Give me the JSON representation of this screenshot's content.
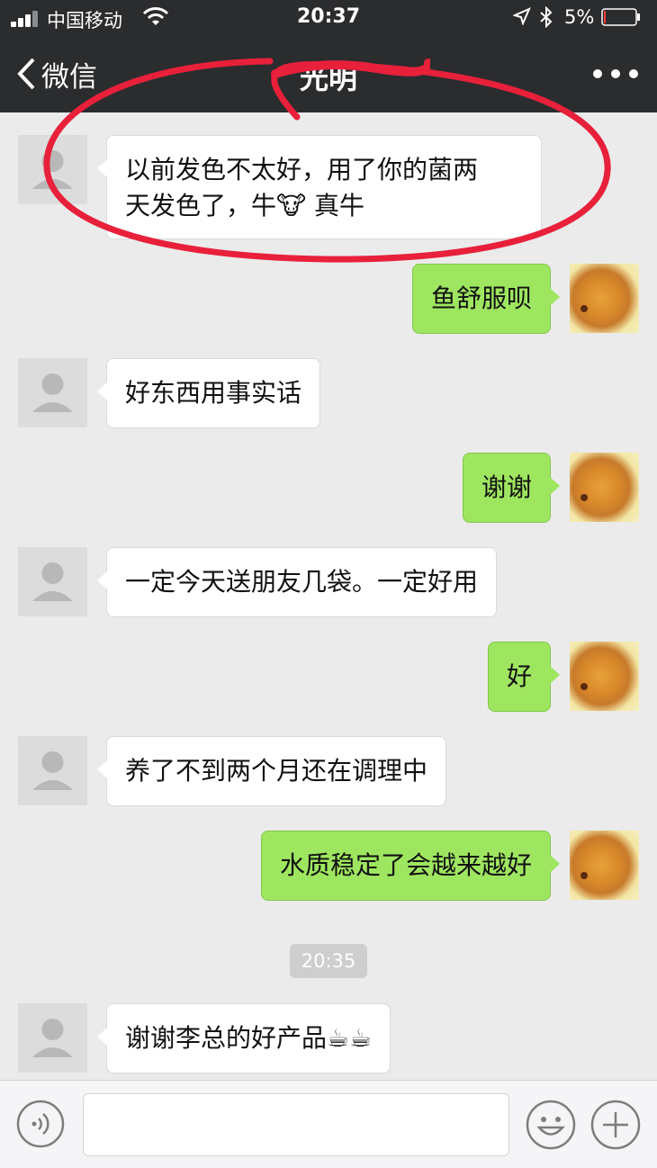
{
  "status_bar": {
    "carrier": "中国移动",
    "time": "20:37",
    "battery_percent": "5%",
    "battery_level": 0.05,
    "battery_color": "#ff3b30"
  },
  "nav": {
    "back_label": "微信",
    "title": "光明",
    "more_icon": "more-dots-icon",
    "back_icon": "chevron-left-icon"
  },
  "colors": {
    "nav_bg": "#2b2c2e",
    "chat_bg": "#ebebeb",
    "outgoing_bubble": "#9fe660",
    "incoming_bubble": "#ffffff",
    "annotation_red": "#e8203a"
  },
  "messages": [
    {
      "side": "in",
      "text": "以前发色不太好，用了你的菌两",
      "text2": "天发色了，牛🐮 真牛"
    },
    {
      "side": "out",
      "text": "鱼舒服呗"
    },
    {
      "side": "in",
      "text": "好东西用事实话"
    },
    {
      "side": "out",
      "text": "谢谢"
    },
    {
      "side": "in",
      "text": "一定今天送朋友几袋。一定好用"
    },
    {
      "side": "out",
      "text": "好"
    },
    {
      "side": "in",
      "text": "养了不到两个月还在调理中"
    },
    {
      "side": "out",
      "text": "水质稳定了会越来越好"
    },
    {
      "side": "in",
      "text": "谢谢李总的好产品☕☕"
    }
  ],
  "timestamp": "20:35",
  "input_bar": {
    "voice_icon": "voice-icon",
    "input_value": "",
    "emoji_icon": "smiley-icon",
    "plus_icon": "plus-icon"
  }
}
